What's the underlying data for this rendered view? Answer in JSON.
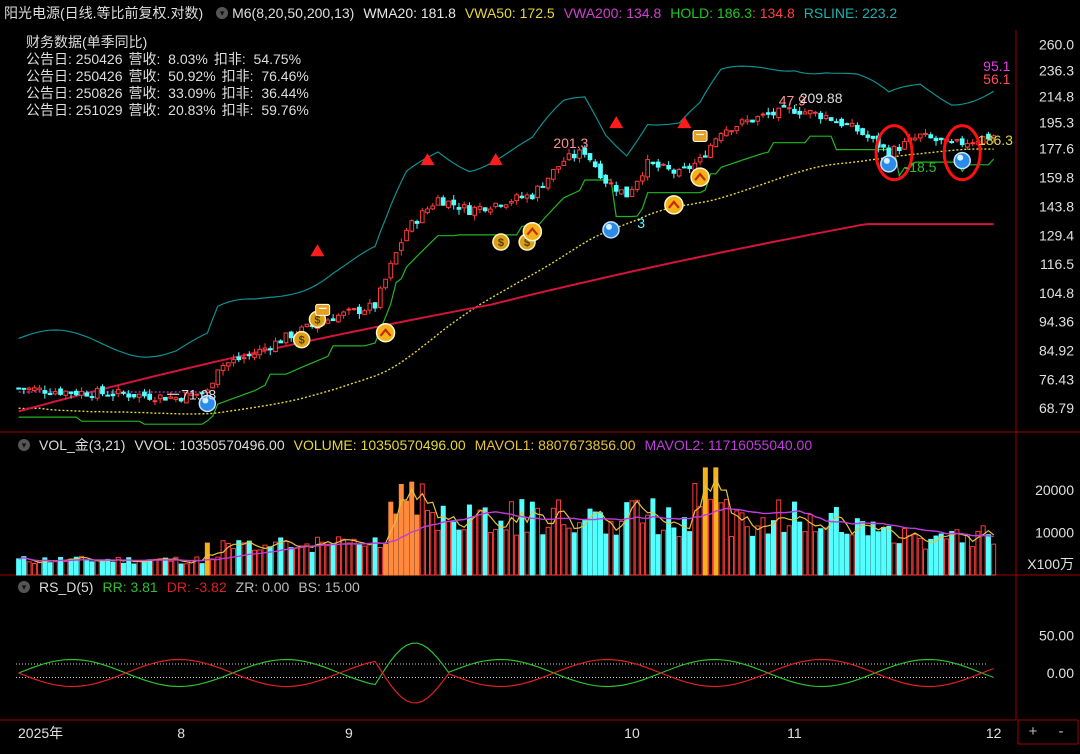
{
  "header": {
    "title": "阳光电源(日线.等比前复权.对数)",
    "indicator": "M6(8,20,50,200,13)",
    "wma20": "WMA20: 181.8",
    "vwa50": "VWA50: 172.5",
    "vwa200": "VWA200: 134.8",
    "hold": "HOLD: 186.3",
    "hold2": ": 134.8",
    "rsline": "RSLINE: 223.2"
  },
  "finance": {
    "title": "财务数据(单季同比)",
    "rows": [
      {
        "date": "公告日: 250426",
        "rev": "营收:  8.03%",
        "np": "扣非:  54.75%"
      },
      {
        "date": "公告日: 250426",
        "rev": "营收:  50.92%",
        "np": "扣非:  76.46%"
      },
      {
        "date": "公告日: 250826",
        "rev": "营收:  33.09%",
        "np": "扣非:  36.44%"
      },
      {
        "date": "公告日: 251029",
        "rev": "营收:  20.83%",
        "np": "扣非:  59.76%"
      }
    ]
  },
  "vol_header": {
    "name": "VOL_金(3,21)",
    "vvol": "VVOL: 10350570496.00",
    "volume": "VOLUME: 10350570496.00",
    "mavol1": "MAVOL1: 8807673856.00",
    "mavol2": "MAVOL2: 11716055040.00"
  },
  "rs_header": {
    "name": "RS_D(5)",
    "rr": "RR: 3.81",
    "dr": "DR: -3.82",
    "zr": "ZR: 0.00",
    "bs": "BS: 15.00"
  },
  "vol_unit": "X100万",
  "buttons": {
    "plus": "+",
    "minus": "-"
  },
  "colors": {
    "up": "#ff3b3b",
    "down": "#54ffff",
    "wma20": "#e6e6e6",
    "vwa50": "#e6d63c",
    "vwa200": "#d4143c",
    "hold": "#22b522",
    "rsline": "#0f8f8f",
    "mavol1": "#e6c23c",
    "mavol2": "#c03cdc",
    "rr": "#2fbf2f",
    "dr": "#e02020",
    "axis": "#a00000"
  },
  "chart_data": [
    {
      "type": "candlestick",
      "name": "price",
      "scale": "log",
      "ylim": [
        64,
        270
      ],
      "xaxis_labels": [
        "2025年",
        "8",
        "9",
        "10",
        "11",
        "12"
      ],
      "xaxis_label_days": [
        0,
        31,
        63,
        117,
        148,
        186
      ],
      "yticks": [
        260.0,
        236.3,
        214.8,
        195.3,
        177.6,
        159.8,
        143.8,
        129.4,
        116.5,
        104.8,
        94.36,
        84.92,
        76.43,
        68.79
      ],
      "annotations": [
        {
          "text": "71.08",
          "day": 31,
          "value": 71.08,
          "color": "#dddddd"
        },
        {
          "text": "201.3",
          "day": 102,
          "value": 178,
          "color": "#ff9090"
        },
        {
          "text": "47.9",
          "day": 145,
          "value": 208,
          "color": "#ff9090"
        },
        {
          "text": "209.88",
          "day": 149,
          "value": 209.88,
          "color": "#dddddd"
        },
        {
          "text": "186.3",
          "day": 183,
          "value": 180,
          "color": "#e6d63c"
        },
        {
          "text": "95.1",
          "day": 184,
          "value": 236,
          "color": "#e040e0"
        },
        {
          "text": "56.1",
          "day": 184,
          "value": 225,
          "color": "#ff5050"
        },
        {
          "text": "-18.5",
          "day": 169,
          "value": 163,
          "color": "#2fbf2f"
        },
        {
          "text": "3",
          "day": 118,
          "value": 133,
          "color": "#54ffff"
        }
      ],
      "markers": {
        "triangles": [
          [
            57,
            119
          ],
          [
            78,
            166
          ],
          [
            91,
            166
          ],
          [
            114,
            190
          ],
          [
            127,
            190
          ]
        ],
        "money": [
          [
            54,
            91
          ],
          [
            57,
            98
          ],
          [
            92,
            130
          ],
          [
            97,
            130
          ]
        ],
        "chevrons": [
          [
            70,
            94
          ],
          [
            98,
            136
          ],
          [
            125,
            150
          ],
          [
            130,
            166
          ]
        ],
        "flags": [
          [
            58,
            98
          ],
          [
            130,
            185
          ]
        ],
        "orbs": [
          [
            36,
            70
          ],
          [
            113,
            132
          ],
          [
            166,
            168
          ],
          [
            180,
            170
          ]
        ]
      },
      "highlight_circles": [
        [
          167,
          175
        ],
        [
          180,
          175
        ]
      ]
    },
    {
      "type": "bar",
      "name": "volume",
      "ylim": [
        0,
        28000
      ],
      "yticks": [
        20000,
        10000
      ],
      "unit": "X100万"
    },
    {
      "type": "line",
      "name": "rs",
      "ylim": [
        -60,
        100
      ],
      "yticks": [
        50.0,
        0.0
      ]
    }
  ]
}
